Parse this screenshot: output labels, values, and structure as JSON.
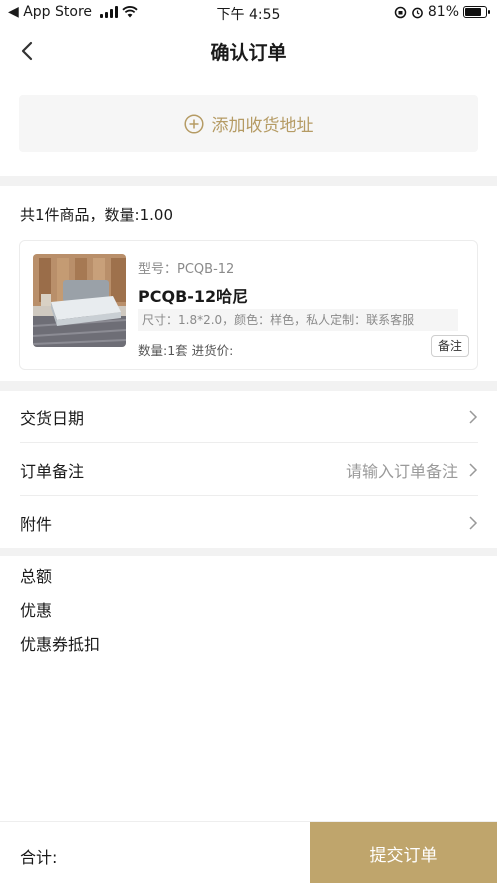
{
  "status_bar": {
    "back_app": "◀ App Store",
    "time": "下午 4:55",
    "battery": "81%",
    "battery_level": 0.81
  },
  "nav": {
    "title": "确认订单"
  },
  "address": {
    "add_label": "添加收货地址",
    "accent_color": "#b59b64"
  },
  "summary": {
    "text": "共1件商品，数量:1.00"
  },
  "product": {
    "model": "型号：PCQB-12",
    "name": "PCQB-12哈尼",
    "spec": "尺寸：1.8*2.0，颜色：样色，私人定制：联系客服",
    "qty_price": "数量:1套 进货价:",
    "note_button": "备注",
    "image_icon": "bed-product-image"
  },
  "rows": {
    "delivery_date": "交货日期",
    "order_note": "订单备注",
    "order_note_placeholder": "请输入订单备注",
    "attachment": "附件"
  },
  "totals": {
    "total": "总额",
    "discount": "优惠",
    "coupon": "优惠券抵扣"
  },
  "bottom": {
    "sum_label": "合计:",
    "submit": "提交订单",
    "submit_color": "#bfa56c"
  }
}
